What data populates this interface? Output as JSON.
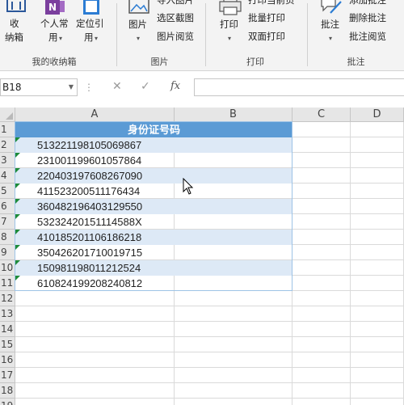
{
  "ribbon": {
    "groups": [
      {
        "label": "我的收纳箱",
        "buttons": [
          "收纳箱",
          "个人常用",
          "定位引用"
        ]
      },
      {
        "label": "图片",
        "big": "图片",
        "small": [
          "导入图片",
          "选区截图",
          "图片阅览"
        ]
      },
      {
        "label": "打印",
        "big": "打印",
        "small": [
          "打印当前页",
          "批量打印",
          "双面打印"
        ]
      },
      {
        "label": "批注",
        "big": "批注",
        "small": [
          "添加批注",
          "删除批注",
          "批注阅览"
        ]
      }
    ],
    "btn_shouna_1": "收",
    "btn_shouna_2": "纳箱",
    "btn_geren_1": "个人常",
    "btn_geren_2": "用",
    "btn_dingwei_1": "定位引",
    "btn_dingwei_2": "用",
    "btn_tupian": "图片",
    "btn_daoru": "导入图片",
    "btn_xuanqu": "选区截图",
    "btn_tupianyuelan": "图片阅览",
    "btn_dayin": "打印",
    "btn_dayindangqian": "打印当前页",
    "btn_piliang": "批量打印",
    "btn_shuangmian": "双面打印",
    "btn_pizhu": "批注",
    "btn_tianjia": "添加批注",
    "btn_shanchu": "删除批注",
    "btn_pizhuyuelan": "批注阅览",
    "label_shouna": "我的收纳箱",
    "label_tupian": "图片",
    "label_dayin": "打印",
    "label_pizhu": "批注"
  },
  "formula_bar": {
    "name_box": "B18",
    "fx_label": "fx",
    "formula_value": ""
  },
  "columns": [
    "A",
    "B",
    "C",
    "D"
  ],
  "rows": [
    "1",
    "2",
    "3",
    "4",
    "5",
    "6",
    "7",
    "8",
    "9",
    "10",
    "11",
    "12",
    "13",
    "14",
    "15",
    "16",
    "17",
    "18",
    "19"
  ],
  "table": {
    "header": "身份证号码",
    "values": [
      "513221198105069867",
      "231001199601057864",
      "220403197608267090",
      "411523200511176434",
      "360482196403129550",
      "53232420151114588X",
      "410185201106186218",
      "350426201710019715",
      "150981198011212524",
      "610824199208240812"
    ]
  },
  "colors": {
    "header_fill": "#5b9bd5",
    "band_fill": "#dde9f6",
    "text_flag": "#1e8b3a"
  }
}
